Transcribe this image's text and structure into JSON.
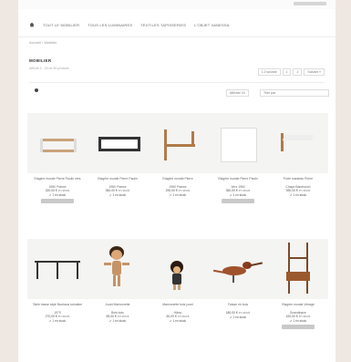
{
  "nav": {
    "items": [
      "Tout le mobilier",
      "Tous les luminaires",
      "Textiles tapisseries",
      "L'objet Vanessa"
    ]
  },
  "breadcrumb": "Accueil › Mobilier",
  "category": {
    "title": "Mobilier",
    "subtitle": "Affiche 1 - 24 de 56 produits",
    "pager": [
      "1 2 suivant",
      "1",
      "2",
      "Suivant »"
    ]
  },
  "filters": {
    "stock": "Afficher 24",
    "sort": "Trier par"
  },
  "products": [
    {
      "name": "Etagère murale Pierre Paulin vers",
      "name2": "1960 France",
      "price": "320,00 €",
      "price_suffix": "en stock",
      "stock": "1 en stock",
      "cta": ""
    },
    {
      "name": "Etagère murale Pierre Paulin",
      "name2": "1960 France",
      "price": "350,00 €",
      "price_suffix": "en stock",
      "stock": "1 en stock",
      "cta": ""
    },
    {
      "name": "Etagère murale Pierre",
      "name2": "1960 France",
      "price": "290,00 €",
      "price_suffix": "en stock",
      "stock": "1 en stock",
      "cta": ""
    },
    {
      "name": "Etagère murale Pierre Paulin",
      "name2": "Vers 1960",
      "price": "350,00 €",
      "price_suffix": "en stock",
      "stock": "1 en stock",
      "cta": ""
    },
    {
      "name": "Porte manteau Pierre",
      "name2": "Chapo Bambouch",
      "price": "390,00 €",
      "price_suffix": "en stock",
      "stock": "1 en stock",
      "cta": ""
    },
    {
      "name": "Table basse style Bauhaus tubulaire",
      "name2": "1970",
      "price": "270,00 €",
      "price_suffix": "en stock",
      "stock": "1 en stock",
      "cta": ""
    },
    {
      "name": "Jouet Marionnette",
      "name2": "Bois bois",
      "price": "85,00 €",
      "price_suffix": "en stock",
      "stock": "1 en stock",
      "cta": ""
    },
    {
      "name": "Marionnette bois jouet",
      "name2": "Hibou",
      "price": "60,00 €",
      "price_suffix": "en stock",
      "stock": "1 en stock",
      "cta": ""
    },
    {
      "name": "Faisan en bois",
      "name2": "",
      "price": "180,00 €",
      "price_suffix": "en stock",
      "stock": "1 en stock",
      "cta": ""
    },
    {
      "name": "Etagère murale Vintage",
      "name2": "Scandinave",
      "price": "420,00 €",
      "price_suffix": "en stock",
      "stock": "1 en stock",
      "cta": ""
    }
  ],
  "colors": {
    "background": "#efe8e2",
    "card_bg": "#f4f4f2",
    "wood": "#b07a4a",
    "button": "#c9c9c9"
  }
}
